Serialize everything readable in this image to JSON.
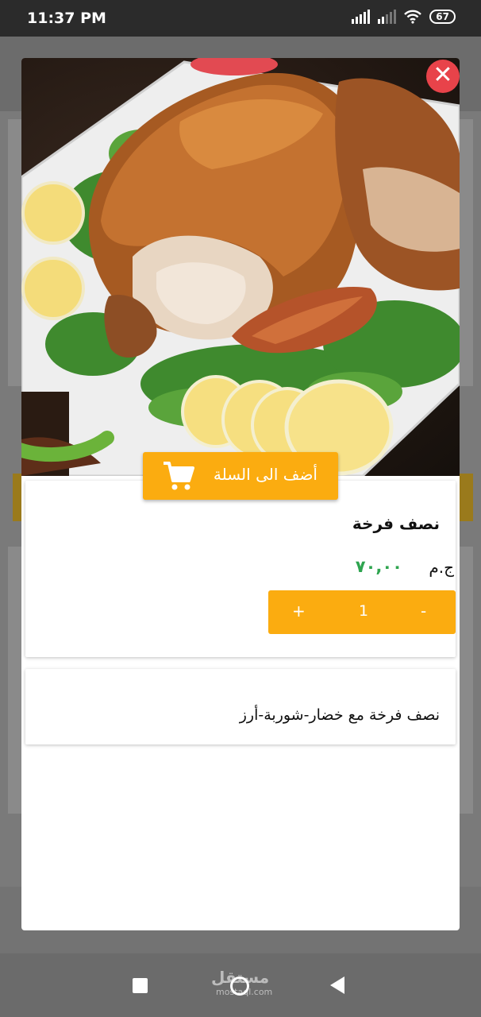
{
  "status_bar": {
    "time": "11:37 PM",
    "battery": "67",
    "icons": [
      "signal-icon",
      "signal-icon",
      "wifi-icon",
      "battery-icon"
    ]
  },
  "product": {
    "name": "نصف فرخة",
    "price": "٧٠,٠٠",
    "currency": "ج.م",
    "quantity": "1",
    "description": "نصف فرخة مع خضار-شوربة-أرز"
  },
  "actions": {
    "add_to_cart": "أضف الى السلة",
    "close": "✕",
    "plus": "+",
    "minus": "-"
  },
  "watermark": {
    "arabic": "مستقل",
    "latin": "mostaql.com"
  },
  "colors": {
    "accent": "#fbac10",
    "price": "#2ea44f",
    "close": "#e8434a"
  }
}
